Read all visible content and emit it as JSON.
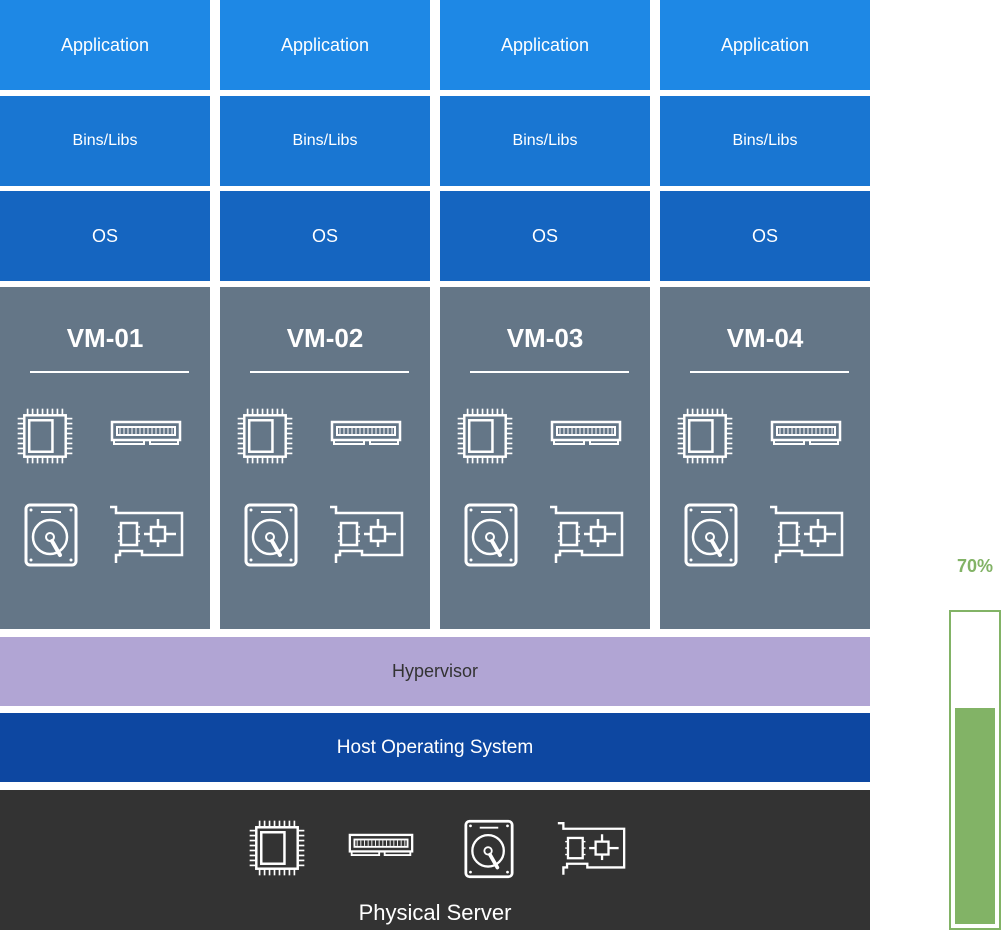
{
  "layers": {
    "application": "Application",
    "bins_libs": "Bins/Libs",
    "os": "OS"
  },
  "vms": [
    {
      "name": "VM-01"
    },
    {
      "name": "VM-02"
    },
    {
      "name": "VM-03"
    },
    {
      "name": "VM-04"
    }
  ],
  "hypervisor": "Hypervisor",
  "host_os": "Host Operating System",
  "physical_server": "Physical Server",
  "utilization": {
    "label": "70%",
    "value": 0.7
  },
  "colors": {
    "application": "#1e88e5",
    "bins_libs": "#1976d2",
    "os": "#1565c0",
    "vm": "#647687",
    "hypervisor": "#b1a5d4",
    "host_os": "#0d47a1",
    "physical": "#333333",
    "gauge": "#82b366"
  }
}
